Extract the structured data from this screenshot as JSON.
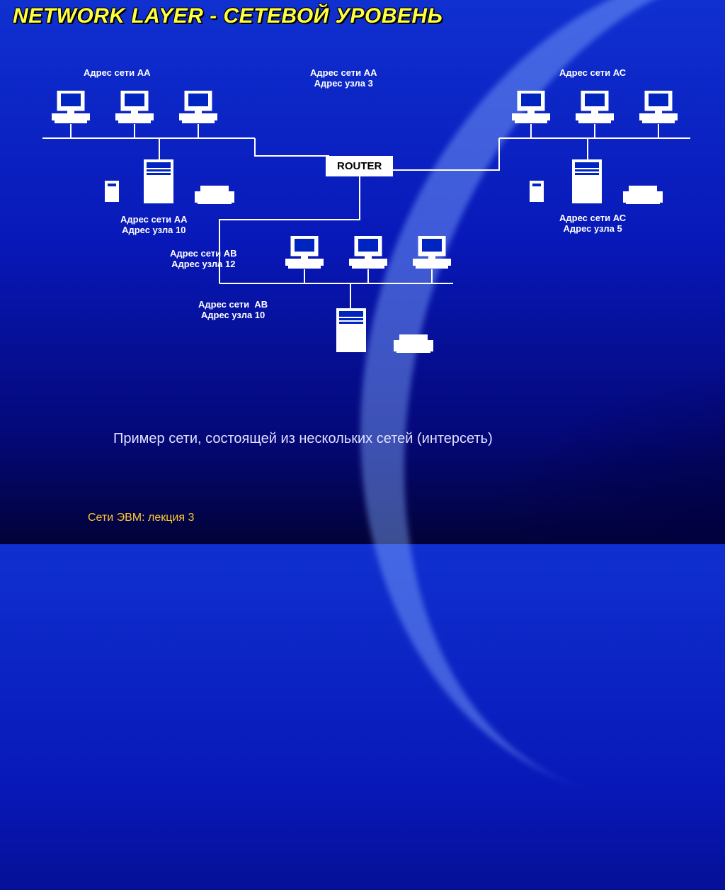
{
  "title": "NETWORK LAYER - СЕТЕВОЙ УРОВЕНЬ",
  "labels": {
    "netAA": "Адрес сети АА",
    "netAA_node3": "Адрес сети АА\nАдрес узла 3",
    "netAC": "Адрес сети АС",
    "router": "ROUTER",
    "netAA_node10": "Адрес сети АА\nАдрес узла 10",
    "netAC_node5": "Адрес сети АС\nАдрес узла 5",
    "netAB_node12": "Адрес сети АВ\nАдрес узла 12",
    "netAB_node10": "Адрес сети  АВ\nАдрес узла 10"
  },
  "caption": "Пример сети, состоящей из нескольких сетей (интерсеть)",
  "footer": "Сети ЭВМ: лекция 3"
}
